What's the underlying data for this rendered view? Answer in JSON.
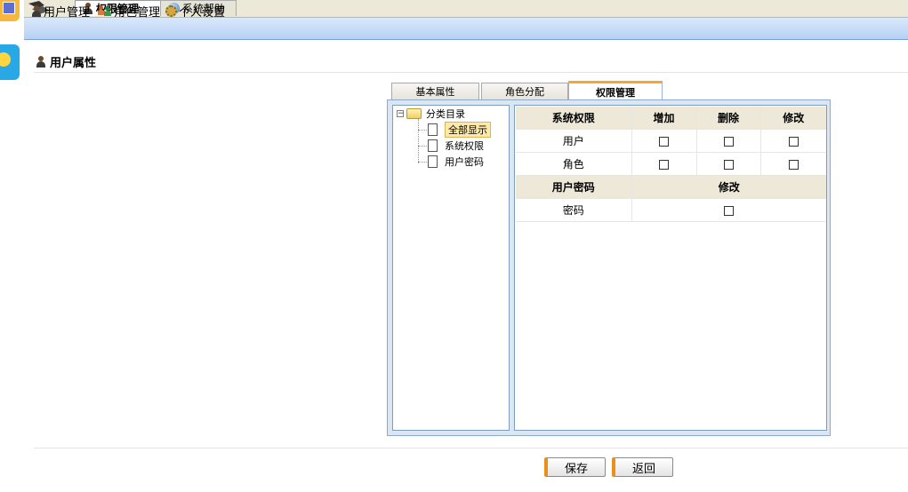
{
  "top_tabs": [
    {
      "label": "权限管理",
      "icon": "user-icon",
      "active": true
    },
    {
      "label": "系统帮助",
      "icon": "globe-help-icon",
      "active": false
    }
  ],
  "menu": {
    "items": [
      {
        "label": "用户管理",
        "icon": "user-icon"
      },
      {
        "label": "角色管理",
        "icon": "users-icon"
      },
      {
        "label": "个人设置",
        "icon": "settings-icon"
      }
    ]
  },
  "page": {
    "title": "用户属性"
  },
  "inner_tabs": [
    {
      "label": "基本属性",
      "active": false
    },
    {
      "label": "角色分配",
      "active": false
    },
    {
      "label": "权限管理",
      "active": true
    }
  ],
  "tree": {
    "root": "分类目录",
    "children": [
      {
        "label": "全部显示",
        "selected": true
      },
      {
        "label": "系统权限",
        "selected": false
      },
      {
        "label": "用户密码",
        "selected": false
      }
    ]
  },
  "permissions": {
    "system": {
      "header": "系统权限",
      "columns": [
        "增加",
        "删除",
        "修改"
      ],
      "rows": [
        {
          "label": "用户",
          "add": false,
          "delete": false,
          "edit": false
        },
        {
          "label": "角色",
          "add": false,
          "delete": false,
          "edit": false
        }
      ]
    },
    "password": {
      "header": "用户密码",
      "column": "修改",
      "rows": [
        {
          "label": "密码",
          "edit": false
        }
      ]
    }
  },
  "buttons": {
    "save": "保存",
    "back": "返回"
  },
  "colors": {
    "menu_bar": "#c8dcf6",
    "accent": "#f0a830",
    "panel_border": "#8fa9c9"
  }
}
